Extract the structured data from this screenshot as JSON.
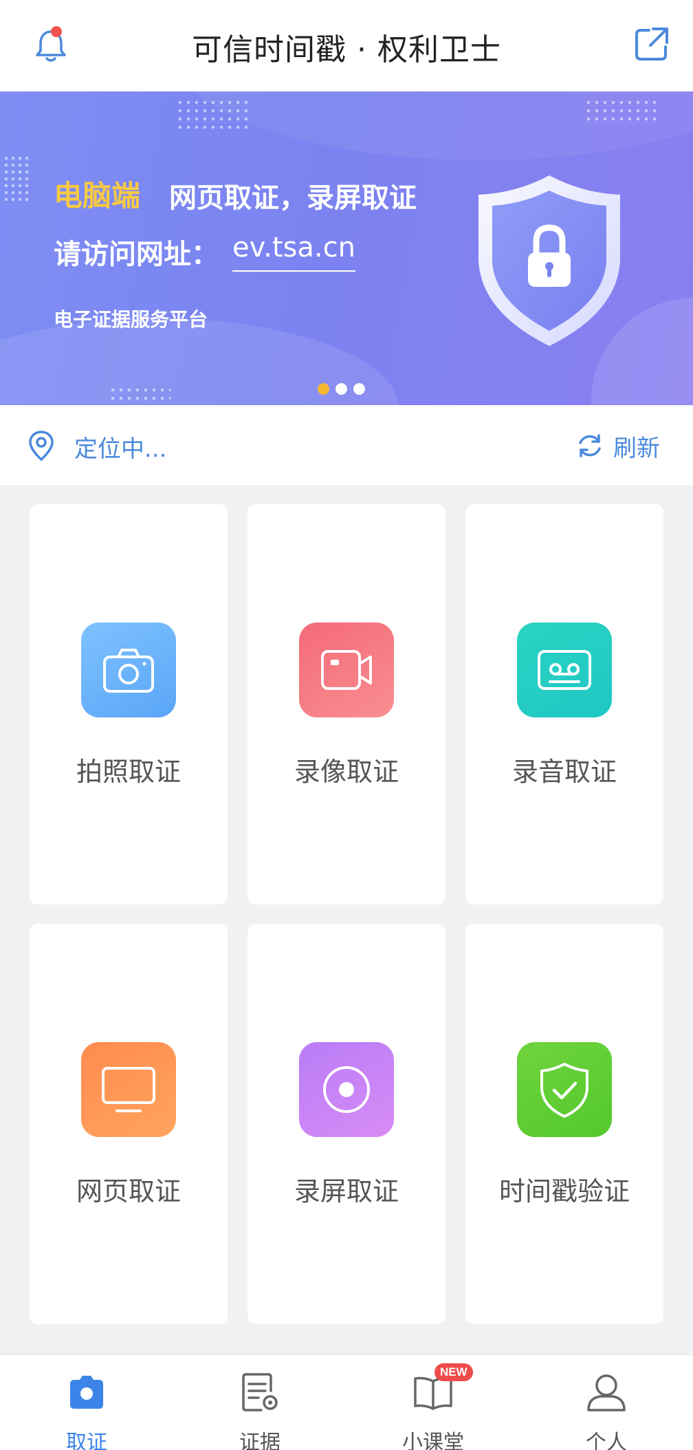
{
  "header": {
    "title": "可信时间戳 · 权利卫士",
    "bell_icon": "bell-icon",
    "share_icon": "external-link-icon",
    "notification_dot_color": "#ef5350"
  },
  "banner": {
    "tag": "电脑端",
    "line1": "网页取证，录屏取证",
    "line2_label": "请访问网址：",
    "line2_url": "ev.tsa.cn",
    "platform": "电子证据服务平台",
    "illustration": "shield-lock-icon",
    "slides_total": 3,
    "active_slide": 1,
    "tag_color": "#f7c945"
  },
  "location": {
    "status_text": "定位中...",
    "refresh_label": "刷新",
    "pin_icon": "location-pin-icon",
    "refresh_icon": "refresh-icon"
  },
  "features": [
    {
      "label": "拍照取证",
      "icon": "camera-icon",
      "color": "blue"
    },
    {
      "label": "录像取证",
      "icon": "video-camera-icon",
      "color": "red"
    },
    {
      "label": "录音取证",
      "icon": "cassette-icon",
      "color": "teal"
    },
    {
      "label": "网页取证",
      "icon": "monitor-icon",
      "color": "orange"
    },
    {
      "label": "录屏取证",
      "icon": "record-icon",
      "color": "purple"
    },
    {
      "label": "时间戳验证",
      "icon": "shield-check-icon",
      "color": "green"
    }
  ],
  "tabbar": {
    "tabs": [
      {
        "label": "取证",
        "icon": "camera-tab-icon",
        "active": true
      },
      {
        "label": "证据",
        "icon": "document-settings-icon",
        "active": false
      },
      {
        "label": "小课堂",
        "icon": "book-icon",
        "active": false,
        "badge": "NEW"
      },
      {
        "label": "个人",
        "icon": "user-icon",
        "active": false
      }
    ],
    "active_color": "#3d84e8"
  }
}
